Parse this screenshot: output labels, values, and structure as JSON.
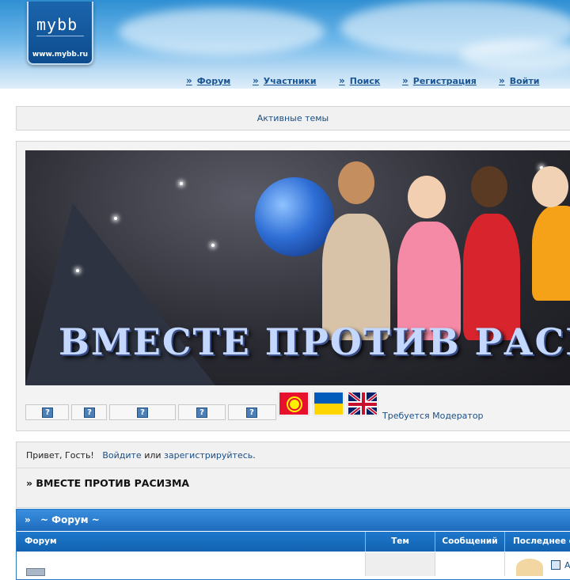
{
  "header": {
    "logo_text": "mybb",
    "logo_url": "www.mybb.ru",
    "nav": [
      {
        "label": "Форум"
      },
      {
        "label": "Участники"
      },
      {
        "label": "Поиск"
      },
      {
        "label": "Регистрация"
      },
      {
        "label": "Войти"
      }
    ]
  },
  "active_topics": {
    "label": "Активные темы"
  },
  "banner": {
    "text": "ВМЕСТЕ  ПРОТИВ  РАСИЗМА",
    "icon_placeholder": "?",
    "moderator_text": "Требуется Модератор",
    "flags": [
      "kyrgyzstan-flag",
      "ukraine-flag",
      "uk-flag"
    ]
  },
  "greeting": {
    "prefix": "Привет, Гость!",
    "login_link": "Войдите",
    "or": "или",
    "register_link": "зарегистрируйтесь",
    "suffix": ".",
    "board_title": "» ВМЕСТЕ ПРОТИВ РАСИЗМА"
  },
  "forum": {
    "category": "~ Форум ~",
    "columns": {
      "forum": "Форум",
      "topics": "Тем",
      "posts": "Сообщений",
      "last": "Последнее с"
    },
    "row_last_text": "А"
  },
  "colors": {
    "accent": "#1d6bbd",
    "link": "#1a4f87",
    "panel": "#f1f1f1"
  }
}
